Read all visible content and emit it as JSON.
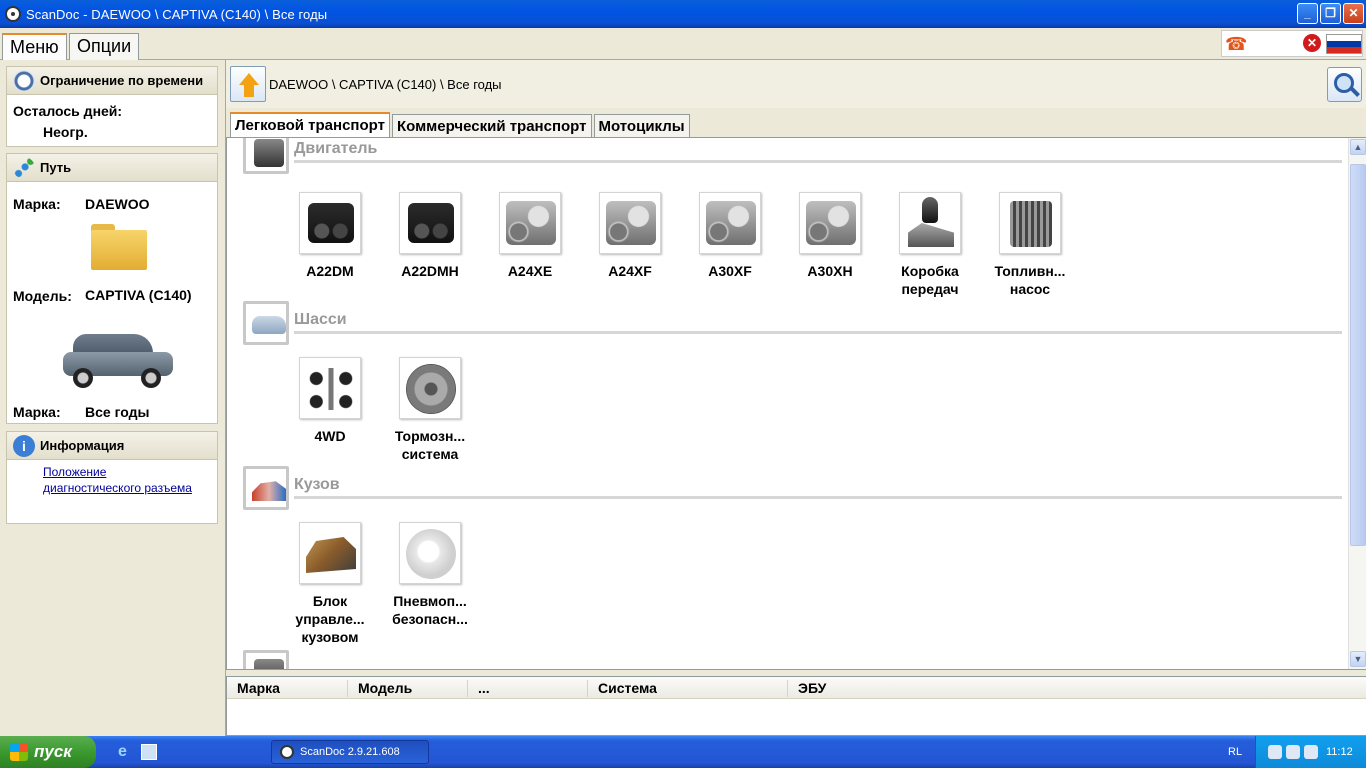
{
  "window": {
    "title": "ScanDoc - DAEWOO \\ CAPTIVA (C140) \\ Все годы",
    "controls": {
      "minimize": "_",
      "maximize": "❐",
      "close": "✕"
    }
  },
  "menu_tabs": [
    "Меню",
    "Опции"
  ],
  "left_panel": {
    "time_limit": {
      "title": "Ограничение по времени",
      "days_label": "Осталось дней:",
      "days_value": "Неогр."
    },
    "path": {
      "title": "Путь",
      "make_label": "Марка:",
      "make_value": "DAEWOO",
      "model_label": "Модель:",
      "model_value": "CAPTIVA (C140)",
      "year_label": "Марка:",
      "year_value": "Все годы"
    },
    "info": {
      "title": "Информация",
      "link": "Положение диагностического разъема",
      "link_line1": "Положение",
      "link_line2": "диагностического разъема"
    }
  },
  "breadcrumb": "DAEWOO \\ CAPTIVA (C140) \\ Все годы",
  "vehicle_tabs": [
    "Легковой транспорт",
    "Коммерческий транспорт",
    "Мотоциклы"
  ],
  "sections": [
    {
      "title": "Двигатель",
      "items": [
        {
          "l1": "A22DM",
          "l2": "",
          "l3": ""
        },
        {
          "l1": "A22DMH",
          "l2": "",
          "l3": ""
        },
        {
          "l1": "A24XE",
          "l2": "",
          "l3": ""
        },
        {
          "l1": "A24XF",
          "l2": "",
          "l3": ""
        },
        {
          "l1": "A30XF",
          "l2": "",
          "l3": ""
        },
        {
          "l1": "A30XH",
          "l2": "",
          "l3": ""
        },
        {
          "l1": "Коробка",
          "l2": "передач",
          "l3": ""
        },
        {
          "l1": "Топливн...",
          "l2": "насос",
          "l3": ""
        }
      ]
    },
    {
      "title": "Шасси",
      "items": [
        {
          "l1": "4WD",
          "l2": "",
          "l3": ""
        },
        {
          "l1": "Тормозн...",
          "l2": "система",
          "l3": ""
        }
      ]
    },
    {
      "title": "Кузов",
      "items": [
        {
          "l1": "Блок",
          "l2": "управле...",
          "l3": "кузовом"
        },
        {
          "l1": "Пневмоп...",
          "l2": "безопасн...",
          "l3": ""
        }
      ]
    }
  ],
  "table_headers": [
    "Марка",
    "Модель",
    "...",
    "Система",
    "ЭБУ"
  ],
  "taskbar": {
    "start": "пуск",
    "task": "ScanDoc 2.9.21.608",
    "lang": "RL",
    "clock": "11:12"
  },
  "colors": {
    "titlebar": "#0054e3",
    "tab_accent": "#e68b2c",
    "section_title": "#999999",
    "link": "#00009c",
    "flag": [
      "#ffffff",
      "#0039a6",
      "#d52b1e"
    ]
  }
}
